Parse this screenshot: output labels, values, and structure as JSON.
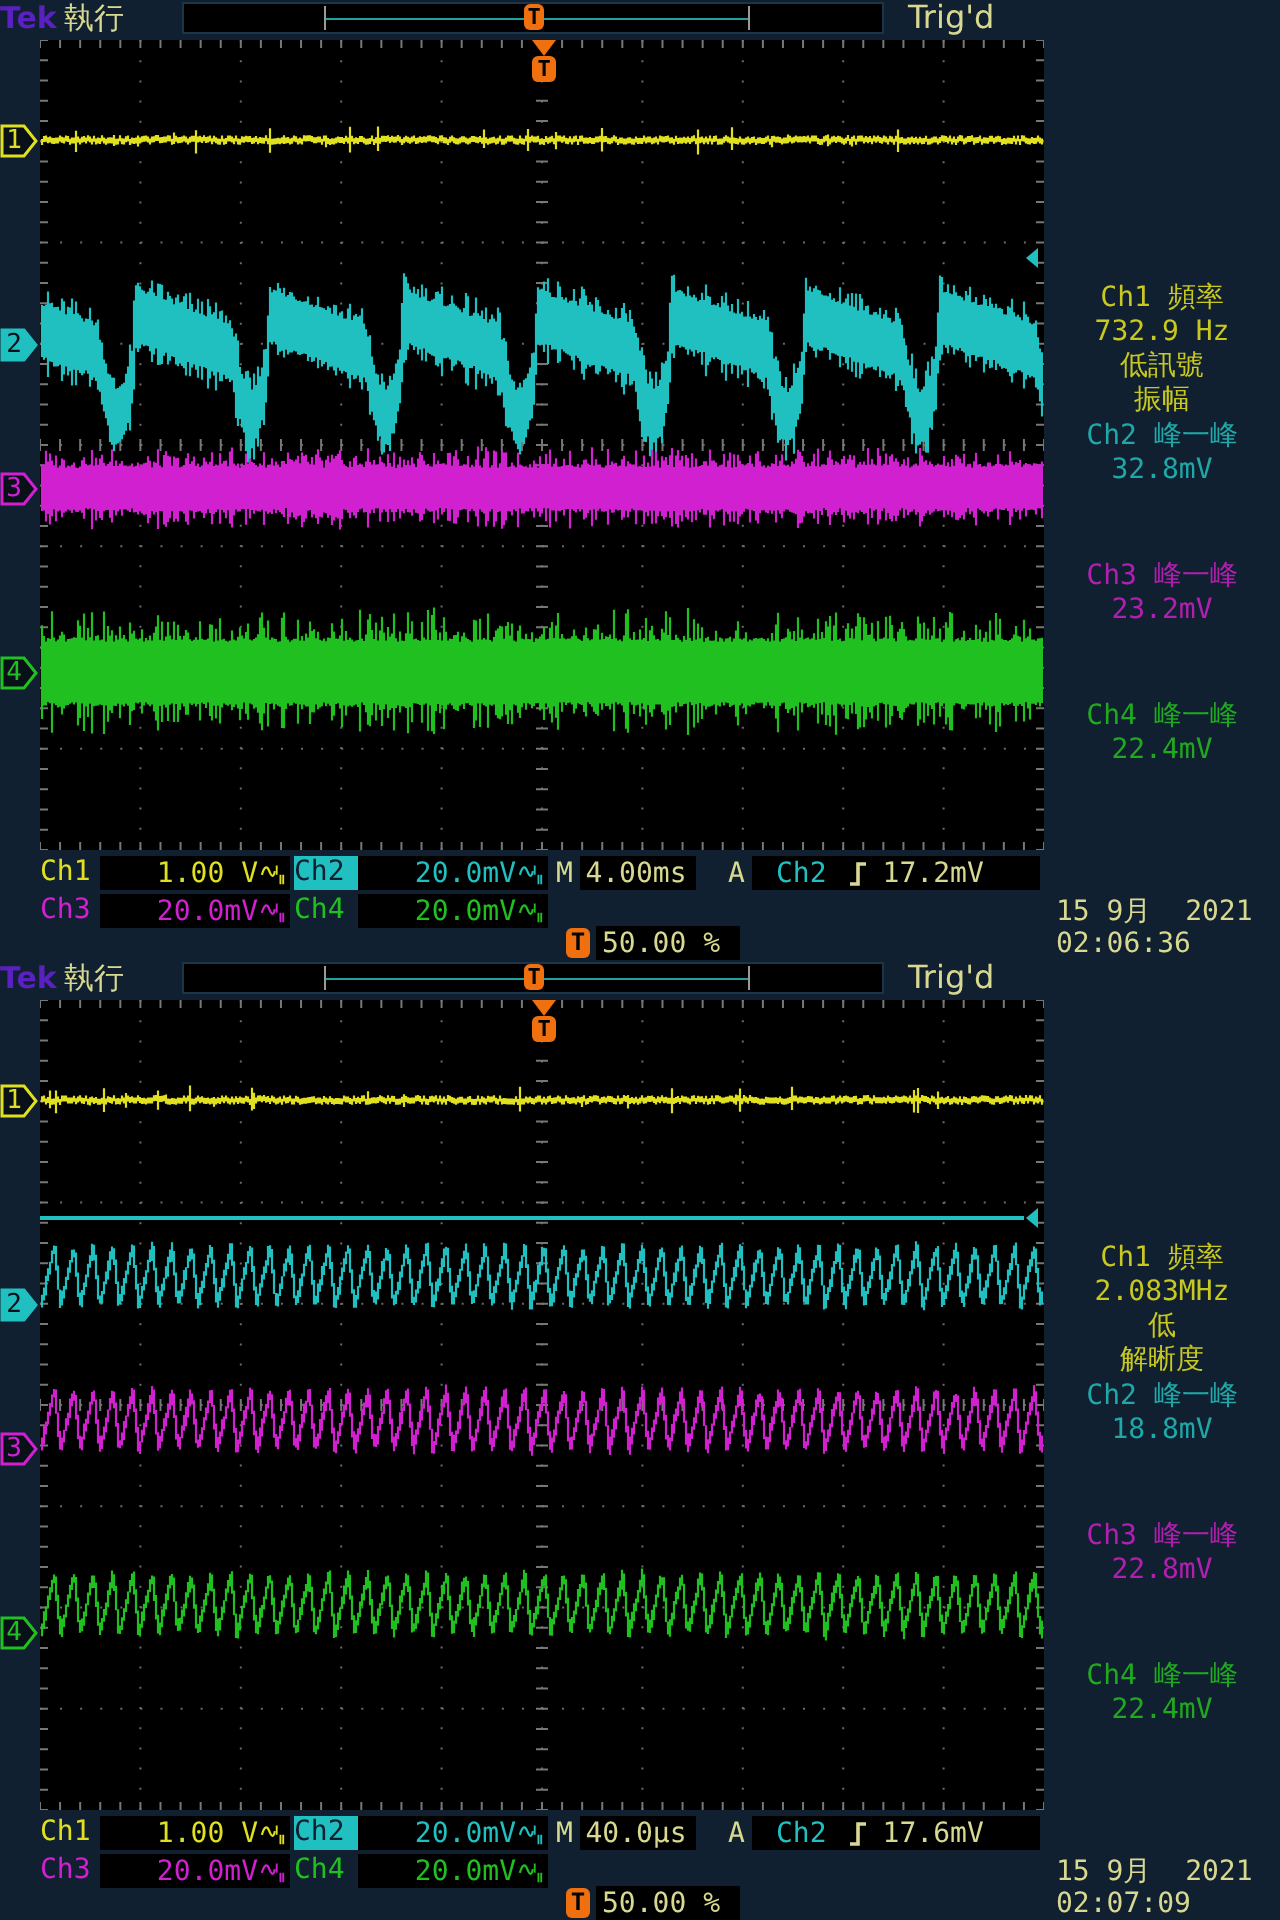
{
  "screens": [
    {
      "brand": "Tek",
      "run_state": "執行",
      "record_marker": "T",
      "trigger_status": "Trig'd",
      "trigger_marker": "T",
      "channels": [
        {
          "marker": "1",
          "label": "Ch1",
          "scale": "1.00 V",
          "color": "#e0e020",
          "selected": false,
          "bandwidth_limited": true,
          "kind": "line"
        },
        {
          "marker": "2",
          "label": "Ch2",
          "scale": "20.0mV",
          "color": "#20c0c0",
          "selected": true,
          "bandwidth_limited": true,
          "kind": "irregular"
        },
        {
          "marker": "3",
          "label": "Ch3",
          "scale": "20.0mV",
          "color": "#d020d0",
          "selected": false,
          "bandwidth_limited": true,
          "kind": "noise"
        },
        {
          "marker": "4",
          "label": "Ch4",
          "scale": "20.0mV",
          "color": "#20c020",
          "selected": false,
          "bandwidth_limited": true,
          "kind": "heavy_noise"
        }
      ],
      "measurements": [
        {
          "color": "#c8c820",
          "lines": [
            "Ch1 頻率",
            "732.9 Hz",
            "低訊號",
            "振幅"
          ]
        },
        {
          "color": "#20a8a8",
          "lines": [
            "Ch2 峰一峰",
            "32.8mV"
          ]
        },
        {
          "color": "#b020b0",
          "lines": [
            "Ch3 峰一峰",
            "23.2mV"
          ]
        },
        {
          "color": "#20a820",
          "lines": [
            "Ch4 峰一峰",
            "22.4mV"
          ]
        }
      ],
      "timebase": {
        "label": "M",
        "value": "4.00ms"
      },
      "trigger": {
        "mode": "A",
        "source": "Ch2",
        "value": "17.2mV",
        "level_line": false
      },
      "trigger_position": {
        "marker": "T",
        "value": "50.00 %"
      },
      "date": "15 9月  2021",
      "time": "02:06:36"
    },
    {
      "brand": "Tek",
      "run_state": "執行",
      "record_marker": "T",
      "trigger_status": "Trig'd",
      "trigger_marker": "T",
      "channels": [
        {
          "marker": "1",
          "label": "Ch1",
          "scale": "1.00 V",
          "color": "#e0e020",
          "selected": false,
          "bandwidth_limited": true,
          "kind": "line"
        },
        {
          "marker": "2",
          "label": "Ch2",
          "scale": "20.0mV",
          "color": "#20c0c0",
          "selected": true,
          "bandwidth_limited": true,
          "kind": "triangle"
        },
        {
          "marker": "3",
          "label": "Ch3",
          "scale": "20.0mV",
          "color": "#d020d0",
          "selected": false,
          "bandwidth_limited": true,
          "kind": "triangle"
        },
        {
          "marker": "4",
          "label": "Ch4",
          "scale": "20.0mV",
          "color": "#20c020",
          "selected": false,
          "bandwidth_limited": true,
          "kind": "triangle"
        }
      ],
      "measurements": [
        {
          "color": "#c8c820",
          "lines": [
            "Ch1 頻率",
            "2.083MHz",
            "低",
            "解晰度"
          ]
        },
        {
          "color": "#20a8a8",
          "lines": [
            "Ch2 峰一峰",
            "18.8mV"
          ]
        },
        {
          "color": "#b020b0",
          "lines": [
            "Ch3 峰一峰",
            "22.8mV"
          ]
        },
        {
          "color": "#20a820",
          "lines": [
            "Ch4 峰一峰",
            "22.4mV"
          ]
        }
      ],
      "timebase": {
        "label": "M",
        "value": "40.0µs"
      },
      "trigger": {
        "mode": "A",
        "source": "Ch2",
        "value": "17.6mV",
        "level_line": true
      },
      "trigger_position": {
        "marker": "T",
        "value": "50.00 %"
      },
      "date": "15 9月  2021",
      "time": "02:07:09"
    }
  ]
}
